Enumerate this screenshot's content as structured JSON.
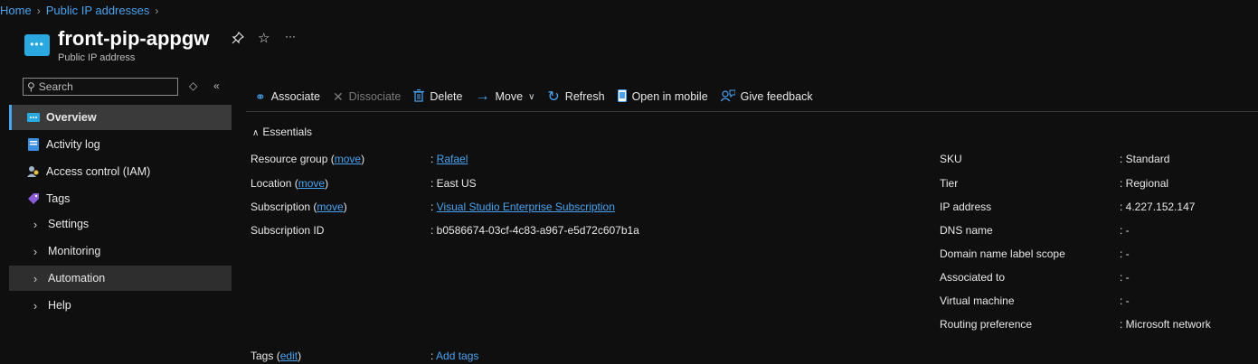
{
  "breadcrumb": {
    "home": "Home",
    "section": "Public IP addresses"
  },
  "header": {
    "title": "front-pip-appgw",
    "subtitle": "Public IP address",
    "pin_icon": "pin-icon",
    "star_icon": "star-icon",
    "more": "···"
  },
  "sidebar": {
    "search_placeholder": "Search",
    "items": [
      {
        "label": "Overview",
        "icon": "overview-icon",
        "selected": true
      },
      {
        "label": "Activity log",
        "icon": "activity-log-icon"
      },
      {
        "label": "Access control (IAM)",
        "icon": "iam-icon"
      },
      {
        "label": "Tags",
        "icon": "tag-icon"
      },
      {
        "label": "Settings",
        "icon": "chevron-right-icon"
      },
      {
        "label": "Monitoring",
        "icon": "chevron-right-icon"
      },
      {
        "label": "Automation",
        "icon": "chevron-right-icon",
        "hover": true
      },
      {
        "label": "Help",
        "icon": "chevron-right-icon"
      }
    ]
  },
  "toolbar": {
    "associate": "Associate",
    "dissociate": "Dissociate",
    "delete": "Delete",
    "move": "Move",
    "refresh": "Refresh",
    "open_mobile": "Open in mobile",
    "feedback": "Give feedback"
  },
  "essentials": {
    "toggle": "Essentials",
    "left": [
      {
        "label": "Resource group",
        "link": "move",
        "value": "Rafael",
        "value_is_link": true
      },
      {
        "label": "Location",
        "link": "move",
        "value": "East US"
      },
      {
        "label": "Subscription",
        "link": "move",
        "value": "Visual Studio Enterprise Subscription",
        "value_is_link": true
      },
      {
        "label": "Subscription ID",
        "value": "b0586674-03cf-4c83-a967-e5d72c607b1a"
      }
    ],
    "right": [
      {
        "label": "SKU",
        "value": "Standard"
      },
      {
        "label": "Tier",
        "value": "Regional"
      },
      {
        "label": "IP address",
        "value": "4.227.152.147"
      },
      {
        "label": "DNS name",
        "value": "-"
      },
      {
        "label": "Domain name label scope",
        "value": "-"
      },
      {
        "label": "Associated to",
        "value": "-"
      },
      {
        "label": "Virtual machine",
        "value": "-"
      },
      {
        "label": "Routing preference",
        "value": "Microsoft network"
      }
    ],
    "tags": {
      "label": "Tags",
      "link": "edit",
      "value": "Add tags"
    }
  },
  "colors": {
    "accent": "#4aa3f0",
    "background": "#0f0f0f",
    "selected": "#3a3a3a"
  }
}
